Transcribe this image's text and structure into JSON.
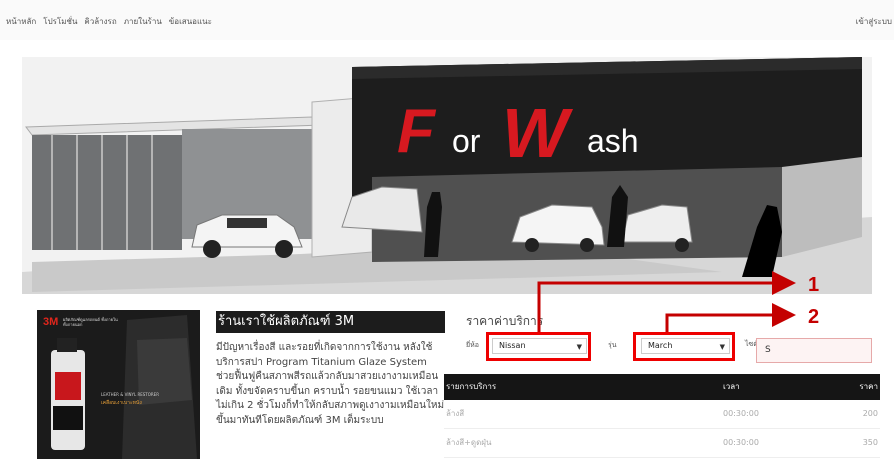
{
  "nav": {
    "items": [
      "หน้าหลัก",
      "โปรโมชั่น",
      "คิวล้างรถ",
      "ภายในร้าน",
      "ข้อเสนอแนะ"
    ],
    "login": "เข้าสู่ระบบ"
  },
  "hero": {
    "brand_part1": "F",
    "brand_part2": "or",
    "brand_part3": "W",
    "brand_part4": "ash"
  },
  "promo": {
    "logo": "3M",
    "subtitle": "ผลิตภัณฑ์ดูแลรถยนต์ ทั้งภายใน ทั้งภายนอก",
    "caption": "LEATHER & VINYL RESTORER",
    "caption2": "เคลือบเงาเบาะหนัง"
  },
  "description": {
    "title": "ร้านเราใช้ผลิตภัณฑ์ 3M",
    "text": "มีปัญหาเรื่องสี และรอยที่เกิดจากการใช้งาน หลังใช้บริการสปา Program Titanium Glaze System ช่วยฟื้นฟูคืนสภาพสีรถแล้วกลับมาสวยเงางามเหมือนเดิม ทั้งขจัดคราบขี้นก คราบน้ำ รอยขนแมว ใช้เวลาไม่เกิน 2 ชั่วโมงก็ทำให้กลับสภาพดูเงางามเหมือนใหม่ขึ้นมาทันทีโดยผลิตภัณฑ์ 3M เต็มระบบ"
  },
  "pricing": {
    "title": "ราคาค่าบริการ",
    "brand_label": "ยี่ห้อ",
    "brand_value": "Nissan",
    "model_label": "รุ่น",
    "model_value": "March",
    "size_label": "ไซต์",
    "size_value": "S",
    "table": {
      "headers": [
        "รายการบริการ",
        "เวลา",
        "ราคา"
      ],
      "rows": [
        [
          "ล้างสี",
          "00:30:00",
          "200"
        ],
        [
          "ล้างสี+ดูดฝุ่น",
          "00:30:00",
          "350"
        ]
      ]
    }
  },
  "callouts": {
    "first": "1",
    "second": "2"
  },
  "colors": {
    "highlight": "#e00000",
    "brand_red": "#d71920",
    "table_head": "#151515"
  }
}
